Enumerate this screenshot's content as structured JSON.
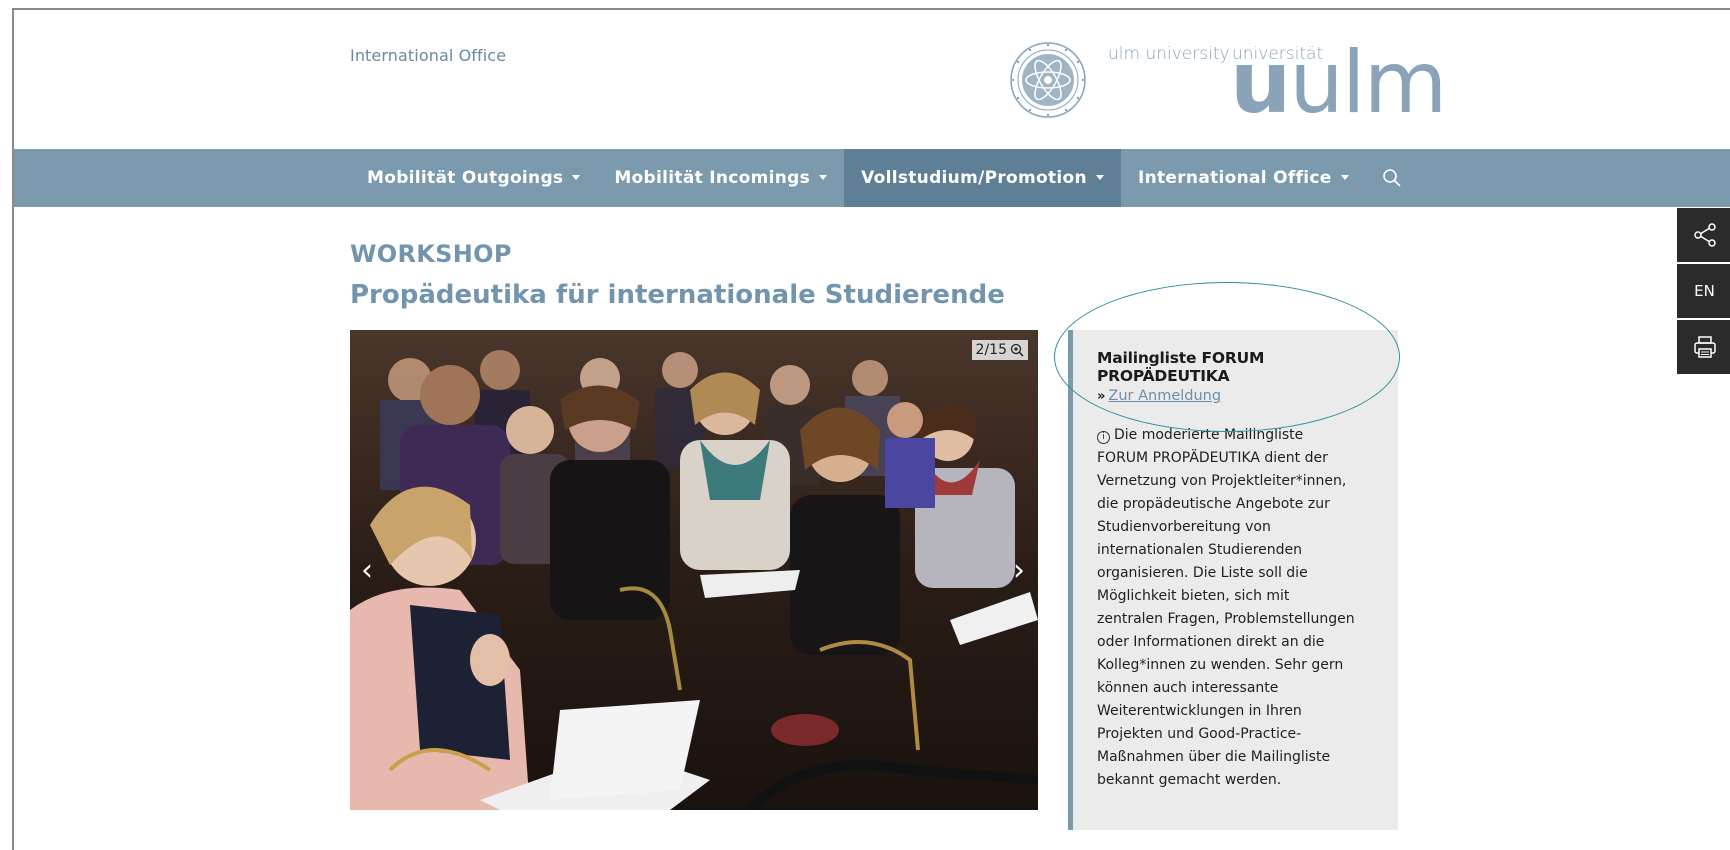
{
  "header": {
    "office_link": "International Office",
    "logo_en": "ulm university",
    "logo_de": "universität",
    "logo_mark_bold": "u",
    "logo_mark_rest": "ulm"
  },
  "nav": {
    "items": [
      {
        "label": "Mobilität Outgoings",
        "active": false
      },
      {
        "label": "Mobilität Incomings",
        "active": false
      },
      {
        "label": "Vollstudium/Promotion",
        "active": true
      },
      {
        "label": "International Office",
        "active": false
      }
    ],
    "search_icon": "search-icon"
  },
  "side_tools": {
    "share_icon": "share-icon",
    "language": "EN",
    "print_icon": "print-icon"
  },
  "page": {
    "kicker": "WORKSHOP",
    "title": "Propädeutika für internationale Studierende"
  },
  "slider": {
    "counter": "2/15",
    "zoom_icon": "zoom-in-icon",
    "prev_icon": "chevron-left-icon",
    "next_icon": "chevron-right-icon",
    "prev_glyph": "‹",
    "next_glyph": "›"
  },
  "infobox": {
    "title": "Mailingliste FORUM PROPÄDEUTIKA",
    "link_label": "Zur Anmeldung",
    "info_icon_glyph": "i",
    "text": "Die moderierte Mailingliste FORUM PROPÄDEUTIKA dient der Vernetzung von Projektleiter*innen, die propädeutische Angebote zur Studienvorbereitung von internationalen Studierenden organisieren. Die Liste soll die Möglichkeit bieten, sich mit zentralen Fragen, Problemstellungen oder Informationen direkt an die Kolleg*innen zu wenden. Sehr gern können auch interessante Weiterentwicklungen in Ihren Projekten und Good-Practice-Maßnahmen über die Mailingliste bekannt gemacht werden."
  },
  "colors": {
    "nav_bg": "#7c9aae",
    "nav_active": "#5f7f97",
    "accent_text": "#7294ad",
    "annotation": "#2f8f97"
  }
}
